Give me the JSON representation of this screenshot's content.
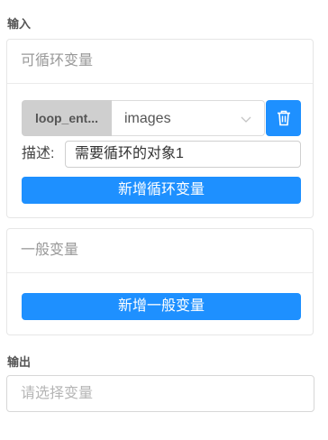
{
  "input_section": {
    "label": "输入"
  },
  "loop_vars_card": {
    "title": "可循环变量",
    "item": {
      "tag": "loop_ent...",
      "select_value": "images",
      "desc_label": "描述:",
      "desc_value": "需要循环的对象1"
    },
    "add_button": "新增循环变量"
  },
  "general_vars_card": {
    "title": "一般变量",
    "add_button": "新增一般变量"
  },
  "output_section": {
    "label": "输出",
    "placeholder": "请选择变量"
  },
  "colors": {
    "primary": "#1e90ff",
    "tag_bg": "#cfcfcf"
  },
  "icons": {
    "delete": "trash-icon",
    "dropdown": "chevron-down-icon"
  }
}
